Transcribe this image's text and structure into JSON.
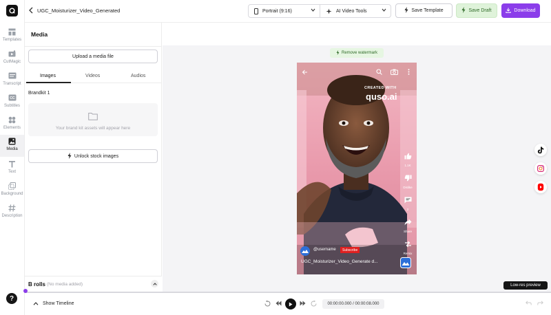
{
  "sidebar": {
    "items": [
      {
        "label": "Templates",
        "icon": "templates-icon"
      },
      {
        "label": "CutMagic",
        "icon": "cutmagic-icon"
      },
      {
        "label": "Transcript",
        "icon": "transcript-icon"
      },
      {
        "label": "Subtitles",
        "icon": "subtitles-icon"
      },
      {
        "label": "Elements",
        "icon": "elements-icon"
      },
      {
        "label": "Media",
        "icon": "media-icon",
        "active": true
      },
      {
        "label": "Text",
        "icon": "text-icon"
      },
      {
        "label": "Background",
        "icon": "background-icon"
      },
      {
        "label": "Description",
        "icon": "description-icon"
      }
    ],
    "help": "?"
  },
  "header": {
    "project_title": "UGC_Moisturizer_Video_Generated",
    "aspect_select": "Portrait (9:16)",
    "tools_select": "AI Video Tools",
    "save_template": "Save Template",
    "save_draft": "Save Draft",
    "download": "Download"
  },
  "media_panel": {
    "title": "Media",
    "upload": "Upload a media file",
    "tabs": [
      "Images",
      "Videos",
      "Audios"
    ],
    "active_tab": "Images",
    "brandkit_label": "Brandkit 1",
    "brandkit_empty": "Your brand kit assets will appear here",
    "unlock": "Unlock stock images",
    "brolls_title": "B rolls",
    "brolls_sub": "(No media added)"
  },
  "preview": {
    "remove_watermark": "Remove watermark",
    "created_with": "CREATED WITH",
    "brand": "quso.ai",
    "actions": {
      "like_count": "1.1K",
      "dislike": "Dislike",
      "comments": "2",
      "share": "Share",
      "remix": "Remix"
    },
    "username": "@username",
    "subscribe": "Subscribe",
    "video_title": "UGC_Moisturizer_Video_Generate d...",
    "low_res": "Low-res preview"
  },
  "social_icons": [
    "tiktok-icon",
    "instagram-icon",
    "youtube-shorts-icon"
  ],
  "timeline": {
    "show_timeline": "Show Timeline",
    "timecode": "00:00:00.000 / 00:00:08.000",
    "progress": 0
  },
  "colors": {
    "accent": "#8b3dea",
    "draft_bg": "#dff3da",
    "subscribe_red": "#e02020"
  }
}
